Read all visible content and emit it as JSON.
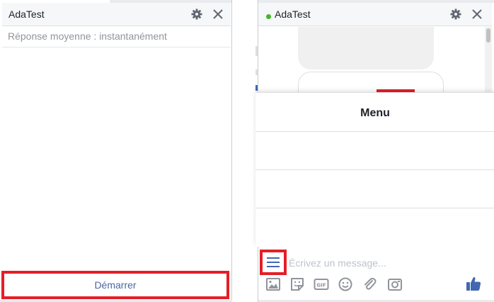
{
  "left_window": {
    "title": "AdaTest",
    "response_time": "Réponse moyenne : instantanément",
    "start_button_label": "Démarrer"
  },
  "right_window": {
    "title": "AdaTest",
    "status": "online",
    "menu_title": "Menu",
    "message_placeholder": "Écrivez un message..."
  },
  "icons": {
    "settings": "gear-icon",
    "close": "close-icon",
    "menu": "hamburger-menu-icon",
    "photo": "photo-icon",
    "sticker": "sticker-icon",
    "gif": "gif-icon",
    "emoji": "emoji-icon",
    "attach": "paperclip-icon",
    "camera": "camera-icon",
    "like": "thumbs-up-icon"
  },
  "colors": {
    "accent": "#4267b2",
    "highlight": "#e41e26",
    "online": "#42b72a",
    "icon_gray": "#90949c"
  }
}
